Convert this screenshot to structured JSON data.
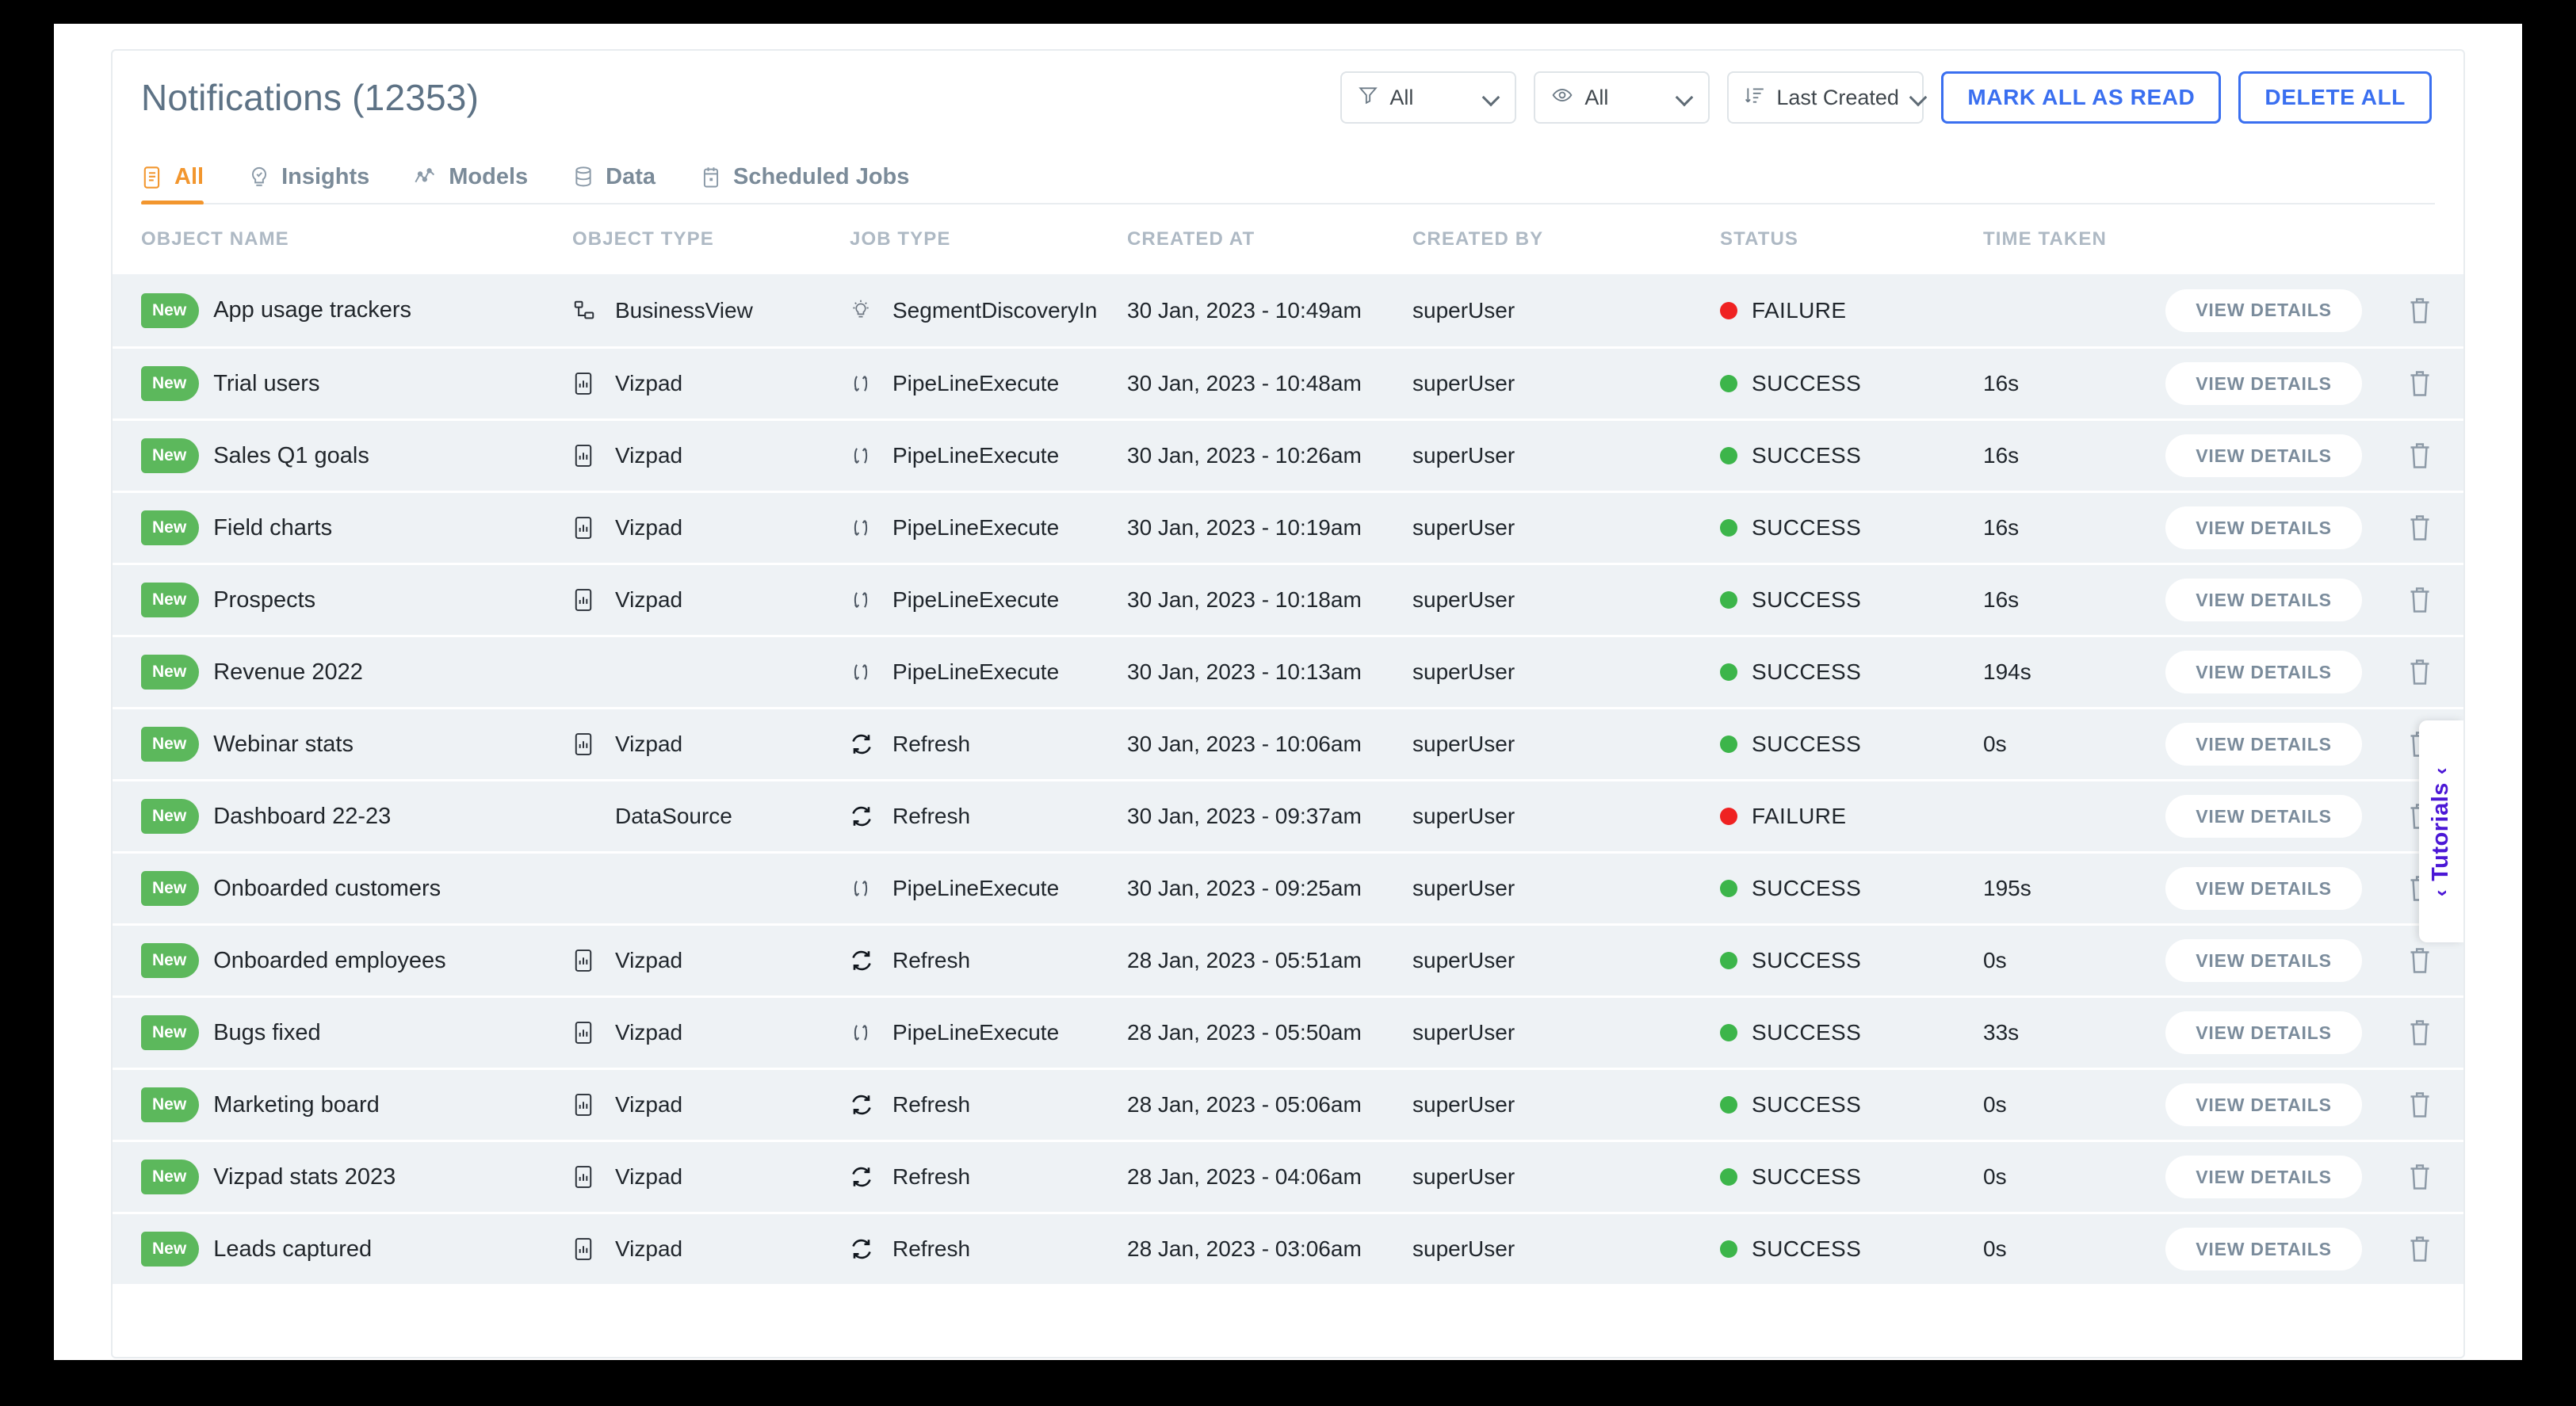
{
  "header": {
    "title": "Notifications",
    "count": "(12353)",
    "filters": [
      {
        "icon": "filter-icon",
        "value": "All"
      },
      {
        "icon": "eye-icon",
        "value": "All"
      },
      {
        "icon": "sort-icon",
        "value": "Last Created"
      }
    ],
    "mark_all_label": "MARK ALL AS READ",
    "delete_all_label": "DELETE ALL"
  },
  "tabs": [
    {
      "label": "All",
      "icon": "document-list-icon",
      "active": true
    },
    {
      "label": "Insights",
      "icon": "lightbulb-check-icon",
      "active": false
    },
    {
      "label": "Models",
      "icon": "line-chart-icon",
      "active": false
    },
    {
      "label": "Data",
      "icon": "database-icon",
      "active": false
    },
    {
      "label": "Scheduled Jobs",
      "icon": "calendar-icon",
      "active": false
    }
  ],
  "table": {
    "columns": [
      "OBJECT NAME",
      "OBJECT TYPE",
      "JOB TYPE",
      "CREATED AT",
      "CREATED BY",
      "STATUS",
      "TIME TAKEN"
    ],
    "badge_label": "New",
    "view_details_label": "VIEW DETAILS",
    "delete_icon": "trash-icon",
    "rows": [
      {
        "badge": "New",
        "name": "App usage trackers",
        "type": "BusinessView",
        "type_icon": "sitemap-icon",
        "job": "SegmentDiscoveryIn",
        "job_icon": "lightbulb-icon",
        "created_at": "30 Jan, 2023 - 10:49am",
        "created_by": "superUser",
        "status": "FAILURE",
        "status_color": "#ef2222",
        "time": ""
      },
      {
        "badge": "New",
        "name": "Trial users",
        "type": "Vizpad",
        "type_icon": "chart-card-icon",
        "job": "PipeLineExecute",
        "job_icon": "pipeline-icon",
        "created_at": "30 Jan, 2023 - 10:48am",
        "created_by": "superUser",
        "status": "SUCCESS",
        "status_color": "#3cb54a",
        "time": "16s"
      },
      {
        "badge": "New",
        "name": "Sales Q1 goals",
        "type": "Vizpad",
        "type_icon": "chart-card-icon",
        "job": "PipeLineExecute",
        "job_icon": "pipeline-icon",
        "created_at": "30 Jan, 2023 - 10:26am",
        "created_by": "superUser",
        "status": "SUCCESS",
        "status_color": "#3cb54a",
        "time": "16s"
      },
      {
        "badge": "New",
        "name": "Field charts",
        "type": "Vizpad",
        "type_icon": "chart-card-icon",
        "job": "PipeLineExecute",
        "job_icon": "pipeline-icon",
        "created_at": "30 Jan, 2023 - 10:19am",
        "created_by": "superUser",
        "status": "SUCCESS",
        "status_color": "#3cb54a",
        "time": "16s"
      },
      {
        "badge": "New",
        "name": "Prospects",
        "type": "Vizpad",
        "type_icon": "chart-card-icon",
        "job": "PipeLineExecute",
        "job_icon": "pipeline-icon",
        "created_at": "30 Jan, 2023 - 10:18am",
        "created_by": "superUser",
        "status": "SUCCESS",
        "status_color": "#3cb54a",
        "time": "16s"
      },
      {
        "badge": "New",
        "name": "Revenue 2022",
        "type": "",
        "type_icon": "",
        "job": "PipeLineExecute",
        "job_icon": "pipeline-icon",
        "created_at": "30 Jan, 2023 - 10:13am",
        "created_by": "superUser",
        "status": "SUCCESS",
        "status_color": "#3cb54a",
        "time": "194s"
      },
      {
        "badge": "New",
        "name": "Webinar stats",
        "type": "Vizpad",
        "type_icon": "chart-card-icon",
        "job": "Refresh",
        "job_icon": "refresh-icon",
        "created_at": "30 Jan, 2023 - 10:06am",
        "created_by": "superUser",
        "status": "SUCCESS",
        "status_color": "#3cb54a",
        "time": "0s"
      },
      {
        "badge": "New",
        "name": "Dashboard 22-23",
        "type": "DataSource",
        "type_icon": "",
        "job": "Refresh",
        "job_icon": "refresh-icon",
        "created_at": "30 Jan, 2023 - 09:37am",
        "created_by": "superUser",
        "status": "FAILURE",
        "status_color": "#ef2222",
        "time": ""
      },
      {
        "badge": "New",
        "name": "Onboarded customers",
        "type": "",
        "type_icon": "",
        "job": "PipeLineExecute",
        "job_icon": "pipeline-icon",
        "created_at": "30 Jan, 2023 - 09:25am",
        "created_by": "superUser",
        "status": "SUCCESS",
        "status_color": "#3cb54a",
        "time": "195s"
      },
      {
        "badge": "New",
        "name": "Onboarded employees",
        "type": "Vizpad",
        "type_icon": "chart-card-icon",
        "job": "Refresh",
        "job_icon": "refresh-icon",
        "created_at": "28 Jan, 2023 - 05:51am",
        "created_by": "superUser",
        "status": "SUCCESS",
        "status_color": "#3cb54a",
        "time": "0s"
      },
      {
        "badge": "New",
        "name": "Bugs fixed",
        "type": "Vizpad",
        "type_icon": "chart-card-icon",
        "job": "PipeLineExecute",
        "job_icon": "pipeline-icon",
        "created_at": "28 Jan, 2023 - 05:50am",
        "created_by": "superUser",
        "status": "SUCCESS",
        "status_color": "#3cb54a",
        "time": "33s"
      },
      {
        "badge": "New",
        "name": "Marketing board",
        "type": "Vizpad",
        "type_icon": "chart-card-icon",
        "job": "Refresh",
        "job_icon": "refresh-icon",
        "created_at": "28 Jan, 2023 - 05:06am",
        "created_by": "superUser",
        "status": "SUCCESS",
        "status_color": "#3cb54a",
        "time": "0s"
      },
      {
        "badge": "New",
        "name": "Vizpad stats 2023",
        "type": "Vizpad",
        "type_icon": "chart-card-icon",
        "job": "Refresh",
        "job_icon": "refresh-icon",
        "created_at": "28 Jan, 2023 - 04:06am",
        "created_by": "superUser",
        "status": "SUCCESS",
        "status_color": "#3cb54a",
        "time": "0s"
      },
      {
        "badge": "New",
        "name": "Leads captured",
        "type": "Vizpad",
        "type_icon": "chart-card-icon",
        "job": "Refresh",
        "job_icon": "refresh-icon",
        "created_at": "28 Jan, 2023 - 03:06am",
        "created_by": "superUser",
        "status": "SUCCESS",
        "status_color": "#3cb54a",
        "time": "0s"
      }
    ]
  },
  "tutorials": {
    "label": "Tutorials",
    "chevron": "‹"
  },
  "colors": {
    "accent_orange": "#f2962e",
    "accent_blue": "#3a6ff0",
    "badge_green": "#5cb85c",
    "success": "#3cb54a",
    "failure": "#ef2222",
    "tutorials_purple": "#4b17d6",
    "row_bg": "#eef2f5"
  }
}
